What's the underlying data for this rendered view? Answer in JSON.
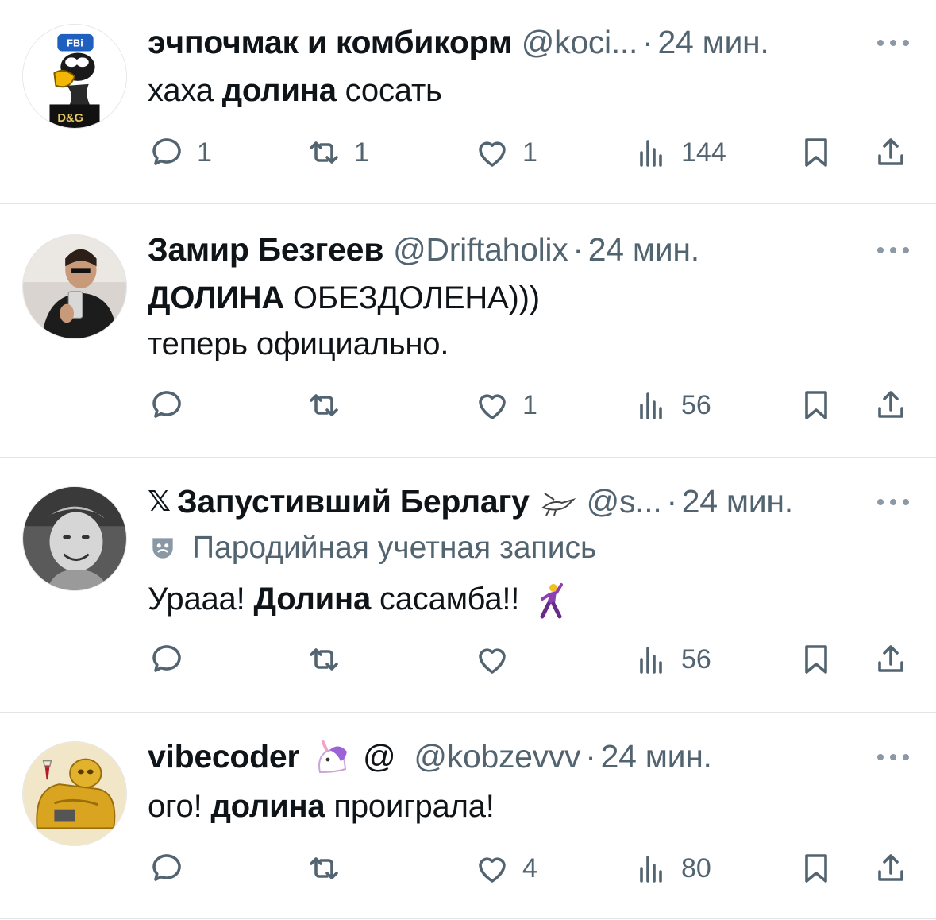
{
  "colors": {
    "text": "#0f1419",
    "secondary": "#536471",
    "divider": "#e3e6e9"
  },
  "tweets": [
    {
      "name": "эчпочмак и комбикорм",
      "handle": "@koci...",
      "dot": "·",
      "time": "24 мин.",
      "avatar_icon": "cartoon-character-fbi-cap-avatar",
      "avatar_text_top": "FBi",
      "avatar_text_shirt": "D&G",
      "lines": [
        {
          "pre": "хаха ",
          "bold": "долина",
          "post": " сосать"
        }
      ],
      "stats": {
        "replies": "1",
        "reposts": "1",
        "likes": "1",
        "views": "144"
      }
    },
    {
      "name": "Замир Безгеев",
      "handle": "@Driftaholix",
      "dot": "·",
      "time": "24 мин.",
      "avatar_icon": "man-selfie-avatar",
      "lines": [
        {
          "pre": "",
          "bold": "ДОЛИНА",
          "post": " ОБЕЗДОЛЕНА)))"
        },
        {
          "pre": "теперь официально.",
          "bold": "",
          "post": ""
        }
      ],
      "stats": {
        "replies": "",
        "reposts": "",
        "likes": "1",
        "views": "56"
      }
    },
    {
      "name": "Запустивший Берлагу",
      "name_prefix": "𝕏",
      "handle": "@s...",
      "dot": "·",
      "time": "24 мин.",
      "avatar_icon": "vintage-bw-portrait-avatar",
      "name_emoji": "bird-icon",
      "parody_label": "Пародийная учетная запись",
      "lines": [
        {
          "pre": "Урааа! ",
          "bold": "Долина",
          "post": " сасамба!!"
        }
      ],
      "body_emoji": "dancing-man-emoji",
      "stats": {
        "replies": "",
        "reposts": "",
        "likes": "",
        "views": "56"
      }
    },
    {
      "name": "vibecoder",
      "handle": "@kobzevvv",
      "dot": "·",
      "time": "24 мин.",
      "at_symbol": "@",
      "avatar_icon": "golden-character-armchair-avatar",
      "name_emoji": "unicorn-emoji",
      "lines": [
        {
          "pre": "ого! ",
          "bold": "долина",
          "post": " проиграла!"
        }
      ],
      "stats": {
        "replies": "",
        "reposts": "",
        "likes": "4",
        "views": "80"
      }
    }
  ]
}
